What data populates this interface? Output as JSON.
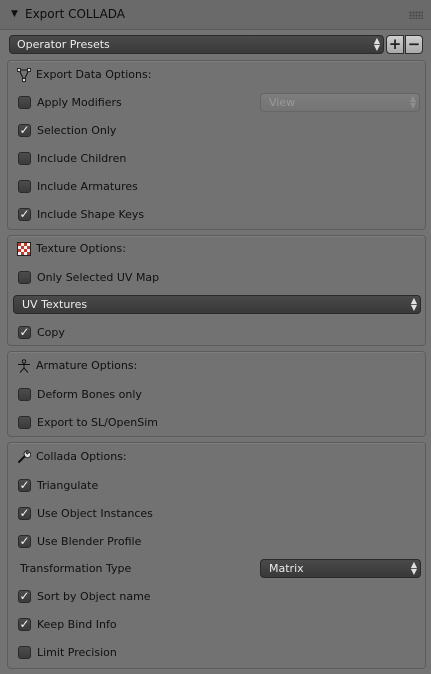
{
  "panel": {
    "title": "Export COLLADA"
  },
  "presets": {
    "label": "Operator Presets",
    "add": "+",
    "remove": "−"
  },
  "updown_glyph": "▲▼",
  "check_glyph": "✓",
  "export_data": {
    "heading": "Export Data Options:",
    "apply_modifiers": {
      "label": "Apply Modifiers",
      "checked": false,
      "mode": "View"
    },
    "selection_only": {
      "label": "Selection Only",
      "checked": true
    },
    "include_children": {
      "label": "Include Children",
      "checked": false
    },
    "include_armatures": {
      "label": "Include Armatures",
      "checked": false
    },
    "include_shape_keys": {
      "label": "Include Shape Keys",
      "checked": true
    }
  },
  "texture": {
    "heading": "Texture Options:",
    "only_selected_uv": {
      "label": "Only Selected UV Map",
      "checked": false
    },
    "uv_textures": "UV Textures",
    "copy": {
      "label": "Copy",
      "checked": true
    }
  },
  "armature": {
    "heading": "Armature Options:",
    "deform_bones": {
      "label": "Deform Bones only",
      "checked": false
    },
    "export_sl": {
      "label": "Export to SL/OpenSim",
      "checked": false
    }
  },
  "collada": {
    "heading": "Collada Options:",
    "triangulate": {
      "label": "Triangulate",
      "checked": true
    },
    "object_instances": {
      "label": "Use Object Instances",
      "checked": true
    },
    "blender_profile": {
      "label": "Use Blender Profile",
      "checked": true
    },
    "transformation_type": {
      "label": "Transformation Type",
      "value": "Matrix"
    },
    "sort_by_name": {
      "label": "Sort by Object name",
      "checked": true
    },
    "keep_bind_info": {
      "label": "Keep Bind Info",
      "checked": true
    },
    "limit_precision": {
      "label": "Limit Precision",
      "checked": false
    }
  }
}
